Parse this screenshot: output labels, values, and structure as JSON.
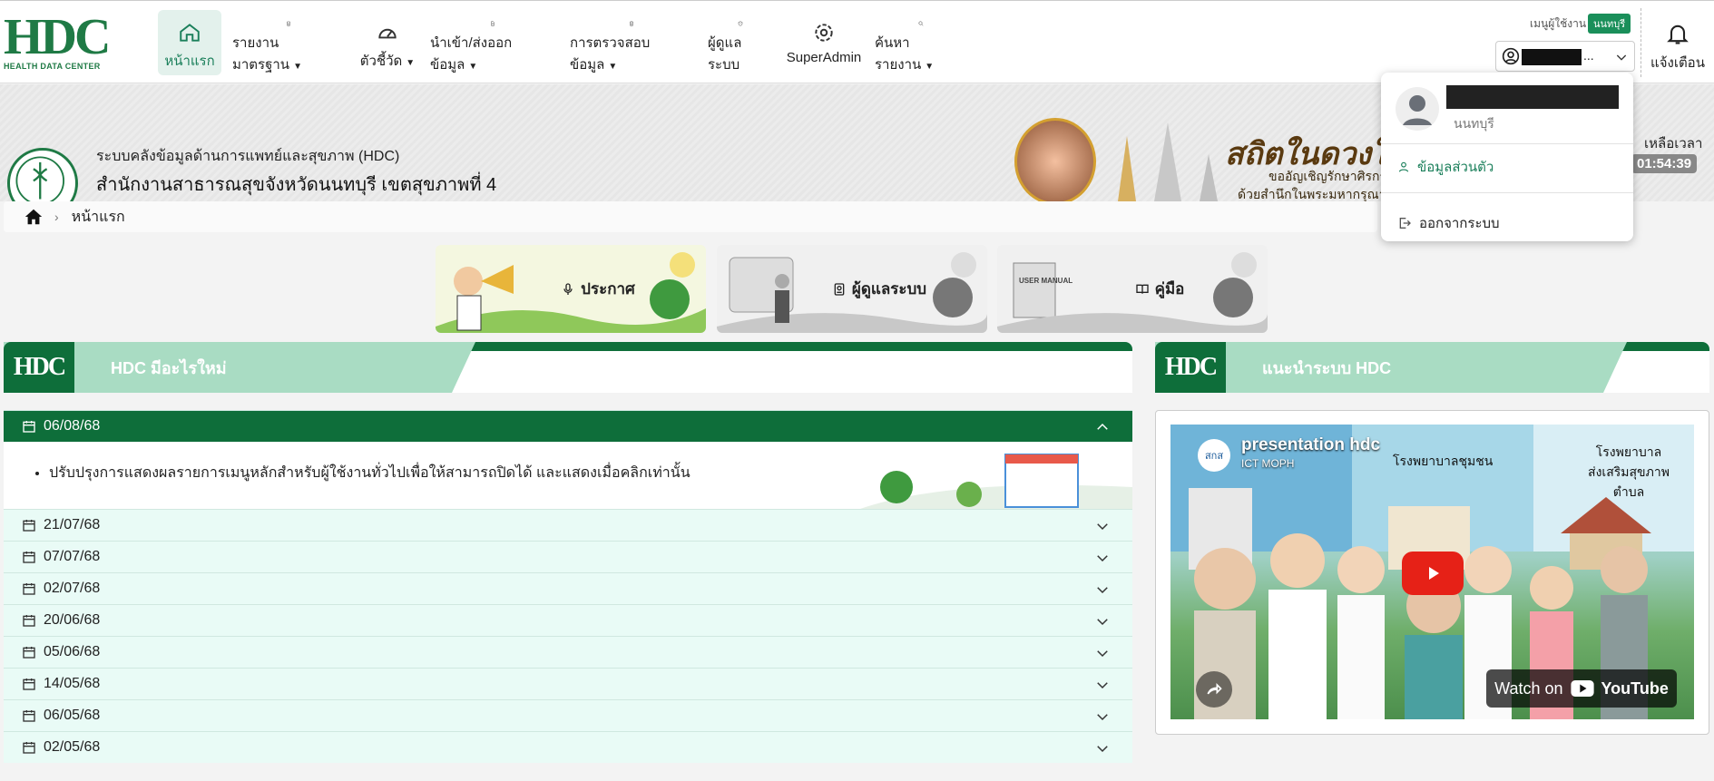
{
  "logo": {
    "text": "HDC",
    "subtitle": "HEALTH DATA CENTER"
  },
  "nav": {
    "items": [
      {
        "label": "หน้าแรก",
        "icon": "home-icon"
      },
      {
        "label": "รายงานมาตรฐาน",
        "icon": "report-icon"
      },
      {
        "label": "ตัวชี้วัด",
        "icon": "gauge-icon"
      },
      {
        "label": "นำเข้า/ส่งออกข้อมูล",
        "icon": "file-upload-icon"
      },
      {
        "label": "การตรวจสอบข้อมูล",
        "icon": "clipboard-chart-icon"
      },
      {
        "label": "ผู้ดูแลระบบ",
        "icon": "shield-icon"
      },
      {
        "label": "SuperAdmin",
        "icon": "gear-icon"
      },
      {
        "label": "ค้นหารายงาน",
        "icon": "search-icon"
      }
    ]
  },
  "user": {
    "label": "เมนูผู้ใช้งาน",
    "badge": "นนทบุรี",
    "dots": "..."
  },
  "bell": {
    "label": "แจ้งเตือน"
  },
  "banner": {
    "system_title": "ระบบคลังข้อมูลด้านการแพทย์และสุขภาพ (HDC)",
    "org_title": "สำนักงานสาธารณสุขจังหวัดนนทบุรี เขตสุขภาพที่ 4",
    "slogan": "สถิตในดวงใจ",
    "slogan_sub": "ขออัญเชิญรักษาศิรกราน",
    "slogan_sub2": "ด้วยสำนึกในพระมหากรุณา",
    "countdown_label": "เหลือเวลา",
    "countdown": "01:54:39"
  },
  "breadcrumb": {
    "current": "หน้าแรก"
  },
  "quick_links": [
    {
      "label": "ประกาศ",
      "icon": "microphone-icon"
    },
    {
      "label": "ผู้ดูแลระบบ",
      "icon": "id-badge-icon"
    },
    {
      "label": "คู่มือ",
      "icon": "book-icon"
    }
  ],
  "manual_text": "USER MANUAL",
  "sections": {
    "news_title": "HDC มีอะไรใหม่",
    "intro_title": "แนะนำระบบ HDC"
  },
  "accordion": {
    "open": {
      "date": "06/08/68",
      "item": "ปรับปรุงการแสดงผลรายการเมนูหลักสำหรับผู้ใช้งานทั่วไปเพื่อให้สามารถปิดได้ และแสดงเมื่อคลิกเท่านั้น"
    },
    "items": [
      "21/07/68",
      "07/07/68",
      "02/07/68",
      "20/06/68",
      "05/06/68",
      "14/05/68",
      "06/05/68",
      "02/05/68"
    ]
  },
  "dropdown": {
    "province": "นนทบุรี",
    "profile": "ข้อมูลส่วนตัว",
    "logout": "ออกจากระบบ"
  },
  "video": {
    "title": "presentation hdc",
    "channel": "ICT MOPH",
    "channel_logo": "สกส",
    "hospital1": "โรงพยาบาลชุมชน",
    "hospital2a": "โรงพยาบาล",
    "hospital2b": "ส่งเสริมสุขภาพตำบล",
    "watch_on": "Watch on",
    "youtube": "YouTube"
  },
  "colors": {
    "primary": "#0e6e3a",
    "accent": "#1a8f5a",
    "light": "#e9fbf6"
  }
}
